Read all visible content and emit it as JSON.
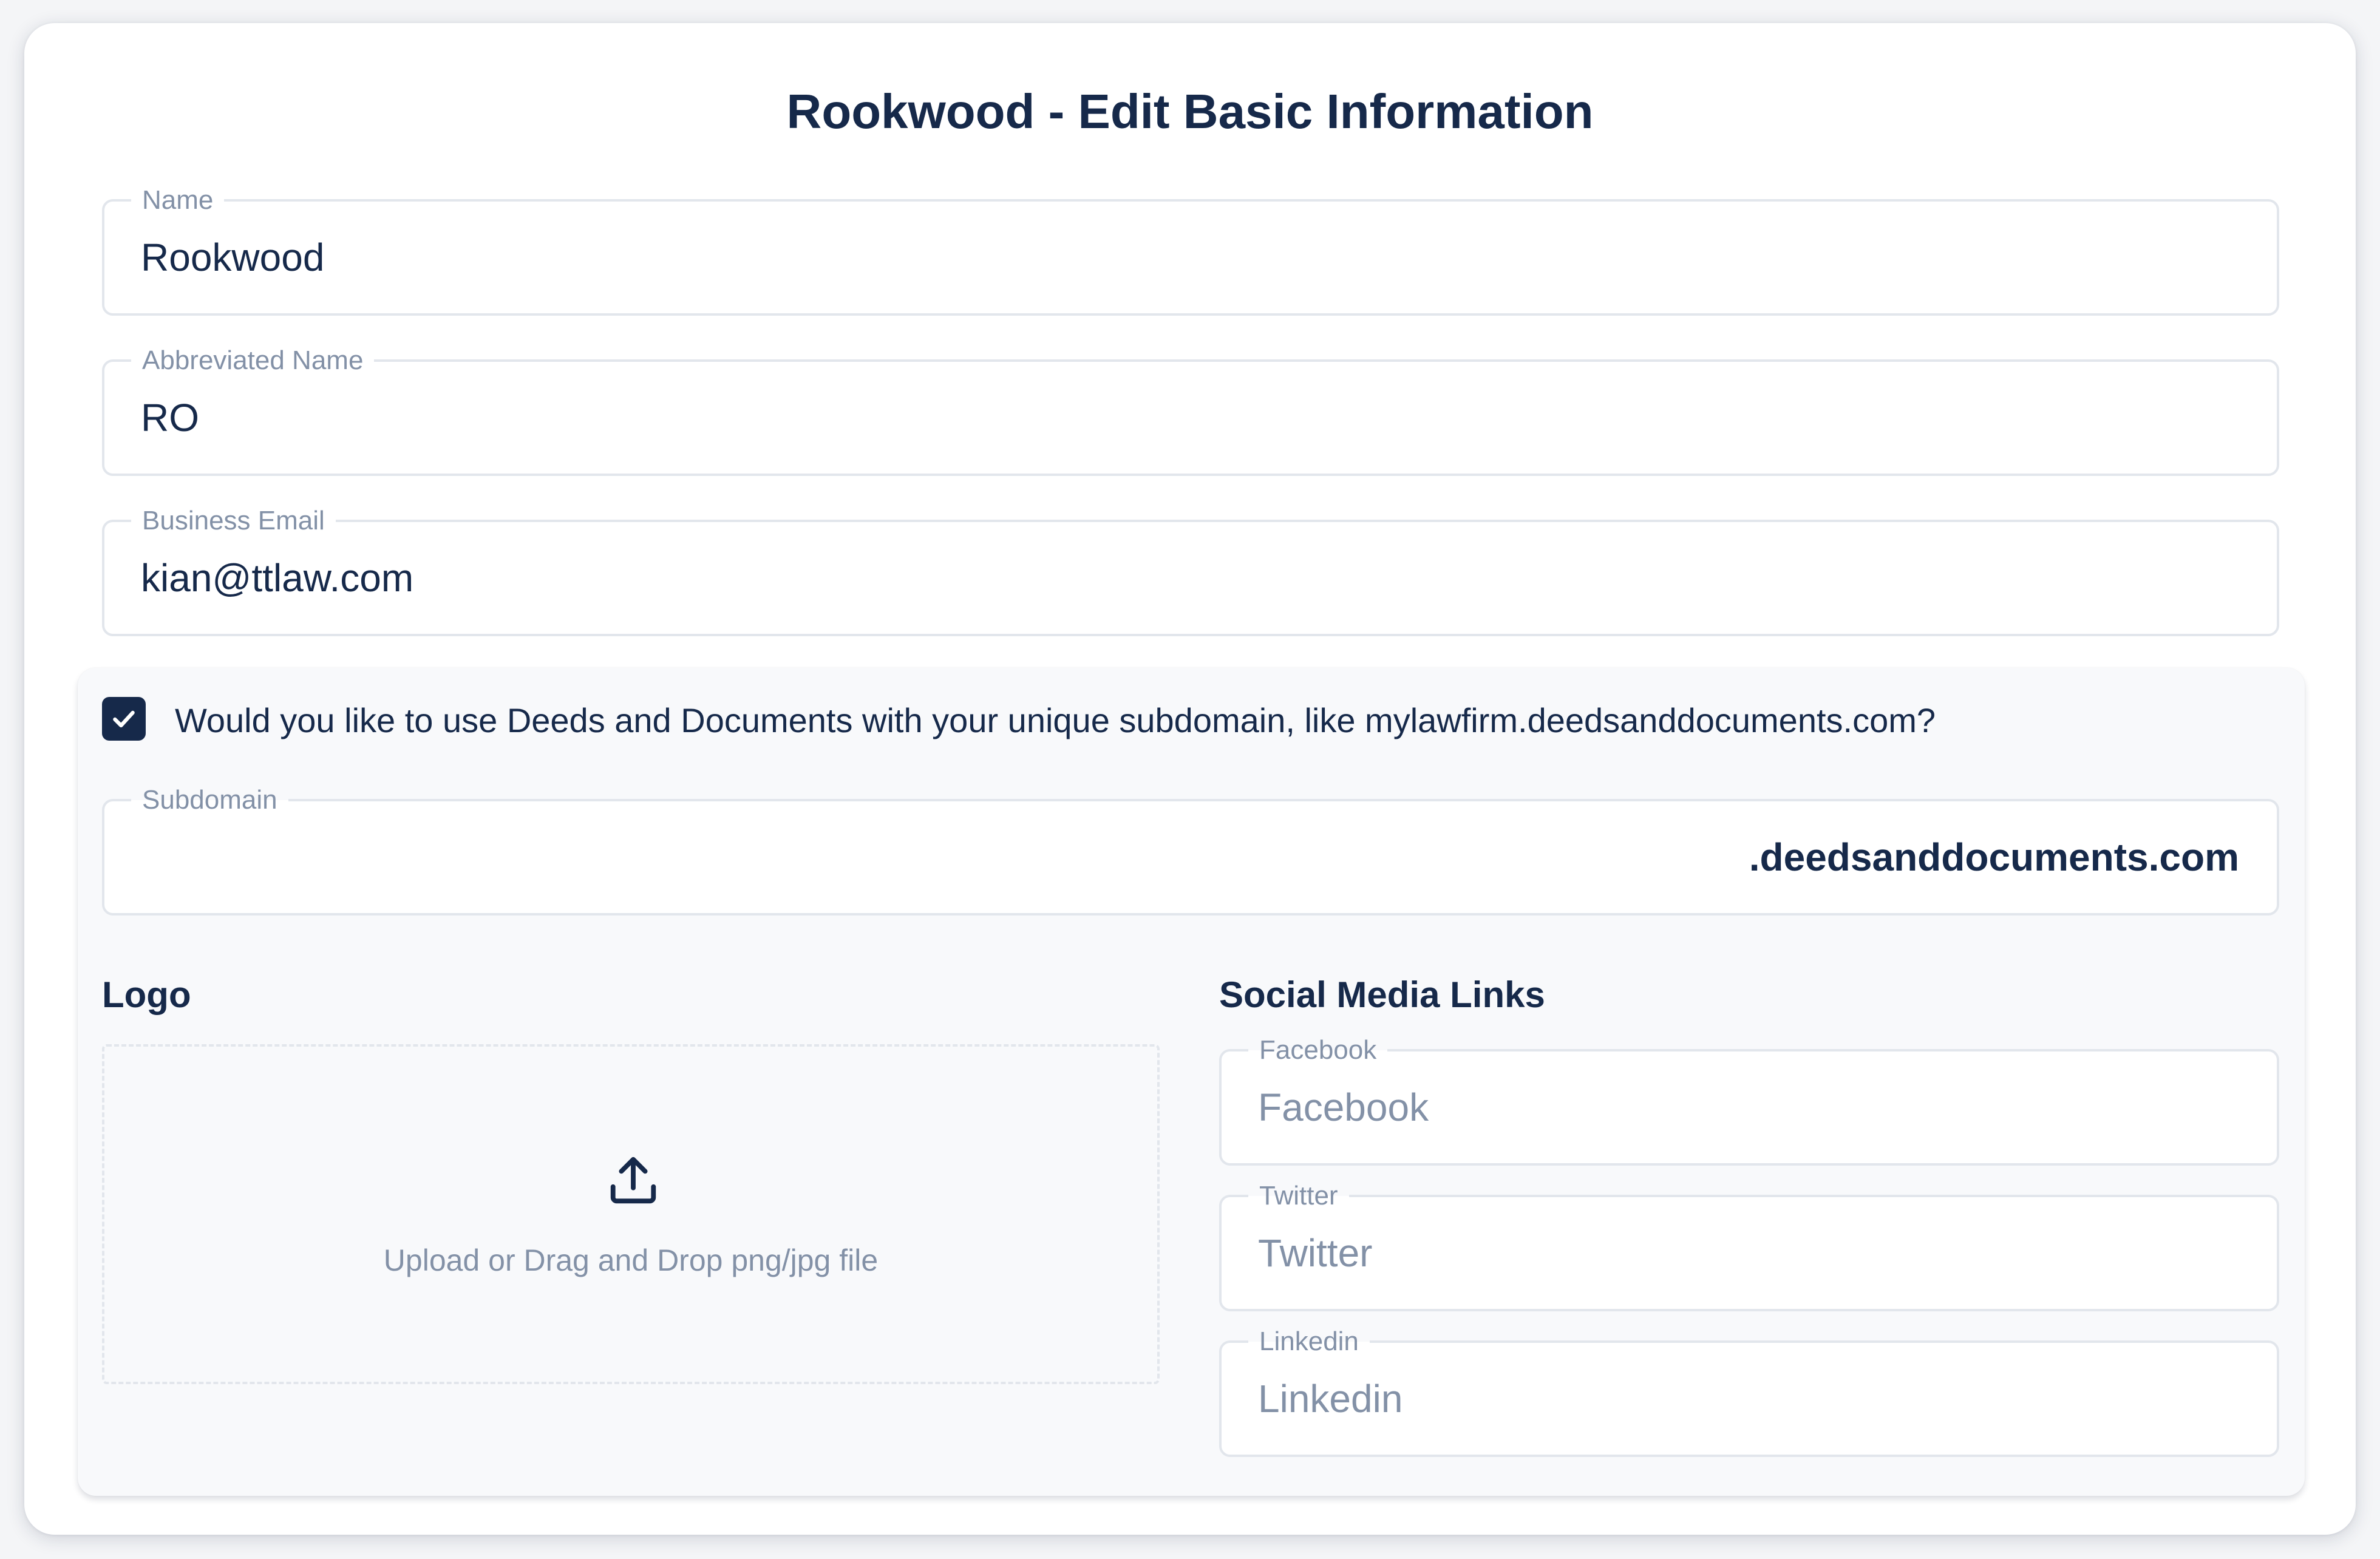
{
  "form": {
    "title": "Rookwood - Edit Basic Information",
    "name": {
      "label": "Name",
      "value": "Rookwood"
    },
    "abbreviated_name": {
      "label": "Abbreviated Name",
      "value": "RO"
    },
    "business_email": {
      "label": "Business Email",
      "value": "kian@ttlaw.com"
    }
  },
  "subdomain_section": {
    "checkbox_checked": true,
    "checkbox_label": "Would you like to use Deeds and Documents with your unique subdomain, like mylawfirm.deedsanddocuments.com?",
    "subdomain": {
      "label": "Subdomain",
      "value": "",
      "suffix": ".deedsanddocuments.com"
    },
    "logo": {
      "heading": "Logo",
      "upload_text": "Upload or Drag and Drop png/jpg file",
      "icon": "upload-icon"
    },
    "social": {
      "heading": "Social Media Links",
      "facebook": {
        "label": "Facebook",
        "placeholder": "Facebook",
        "value": ""
      },
      "twitter": {
        "label": "Twitter",
        "placeholder": "Twitter",
        "value": ""
      },
      "linkedin": {
        "label": "Linkedin",
        "placeholder": "Linkedin",
        "value": ""
      }
    }
  },
  "colors": {
    "primary": "#16294a",
    "muted": "#8391a7",
    "border": "#e2e6ec",
    "section_bg": "#f8f9fb"
  }
}
